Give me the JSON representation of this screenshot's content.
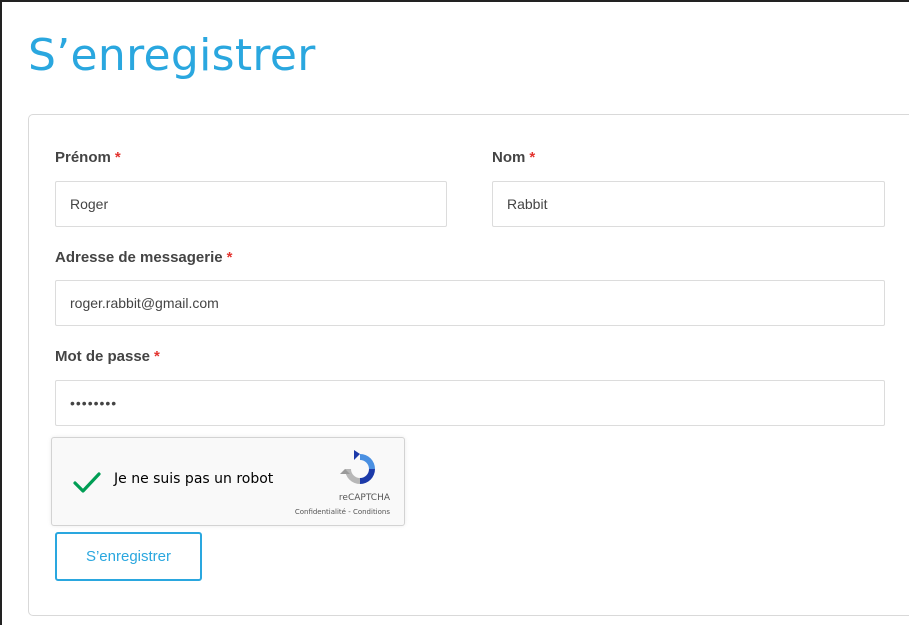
{
  "page": {
    "title": "S’enregistrer"
  },
  "form": {
    "required_marker": "*",
    "first_name": {
      "label": "Prénom",
      "value": "Roger"
    },
    "last_name": {
      "label": "Nom",
      "value": "Rabbit"
    },
    "email": {
      "label": "Adresse de messagerie",
      "value": "roger.rabbit@gmail.com"
    },
    "password": {
      "label": "Mot de passe",
      "value": "rogerpwd"
    },
    "submit_label": "S’enregistrer"
  },
  "recaptcha": {
    "checked": true,
    "text": "Je ne suis pas un robot",
    "brand": "reCAPTCHA",
    "terms": "Confidentialité - Conditions",
    "icon": "recaptcha-logo-icon"
  },
  "colors": {
    "accent": "#2aa7df",
    "required": "#e3342f",
    "check": "#009e55"
  }
}
